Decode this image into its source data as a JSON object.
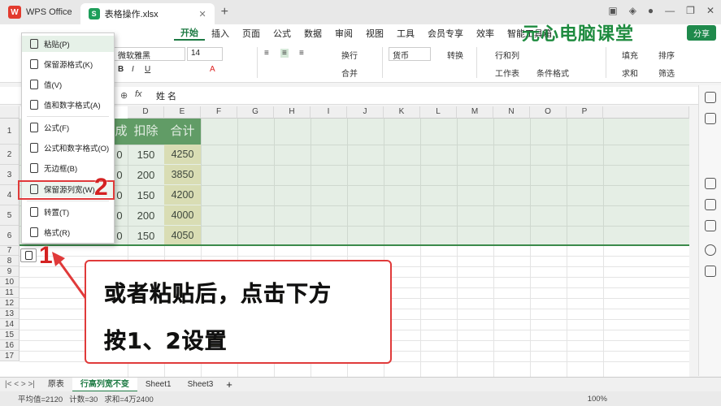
{
  "app": {
    "name": "WPS Office",
    "doc_tab": "表格操作.xlsx"
  },
  "menu": [
    "开始",
    "插入",
    "页面",
    "公式",
    "数据",
    "审阅",
    "视图",
    "工具",
    "会员专享",
    "效率",
    "智能工具箱"
  ],
  "watermark": "元心电脑课堂",
  "share_label": "分享",
  "ribbon": {
    "font_name": "微软雅黑",
    "font_size": "14",
    "wrap": "换行",
    "number_format": "货币",
    "convert": "转换",
    "rows_cols": "行和列",
    "worksheet": "工作表",
    "cond_format": "条件格式",
    "fill": "填充",
    "sort": "排序",
    "sum": "求和",
    "filter": "筛选",
    "merge": "合并"
  },
  "formula_bar": {
    "fx": "fx",
    "value": "姓 名"
  },
  "columns": [
    "D",
    "E",
    "F",
    "G",
    "H",
    "I",
    "J",
    "K",
    "L",
    "M",
    "N",
    "O",
    "P"
  ],
  "rows": [
    "1",
    "2",
    "3",
    "4",
    "5",
    "6",
    "7",
    "8",
    "9",
    "10",
    "11",
    "12",
    "13",
    "14",
    "15",
    "16",
    "17"
  ],
  "table": {
    "headers": [
      "成",
      "扣除",
      "合计"
    ],
    "rows": [
      {
        "c": "0",
        "d": "150",
        "e": "4250"
      },
      {
        "c": "0",
        "d": "200",
        "e": "3850"
      },
      {
        "c": "0",
        "d": "150",
        "e": "4200"
      },
      {
        "c": "0",
        "d": "200",
        "e": "4000"
      },
      {
        "c": "0",
        "d": "150",
        "e": "4050"
      }
    ]
  },
  "paste_menu": [
    "粘贴(P)",
    "保留源格式(K)",
    "值(V)",
    "值和数字格式(A)",
    "公式(F)",
    "公式和数字格式(O)",
    "无边框(B)",
    "保留源列宽(W)",
    "转置(T)",
    "格式(R)"
  ],
  "annotations": {
    "one": "1",
    "two": "2"
  },
  "callout": {
    "line1": "或者粘贴后，点击下方",
    "line2": "按1、2设置"
  },
  "sheet_tabs": [
    "原表",
    "行高列宽不变",
    "Sheet1",
    "Sheet3"
  ],
  "status": {
    "avg": "平均值=2120",
    "count": "计数=30",
    "sum": "求和=4万2400",
    "zoom": "100%"
  }
}
